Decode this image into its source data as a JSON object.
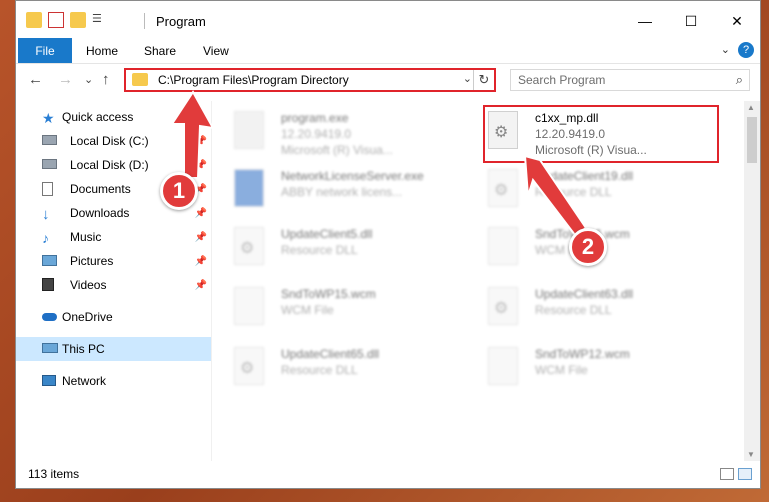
{
  "window": {
    "title": "Program",
    "controls": {
      "minimize": "—",
      "maximize": "☐",
      "close": "✕"
    }
  },
  "ribbon": {
    "file": "File",
    "tabs": [
      "Home",
      "Share",
      "View"
    ],
    "help": "?"
  },
  "address": {
    "path": "C:\\Program Files\\Program Directory",
    "refresh": "↻",
    "dropdown": "⌄"
  },
  "search": {
    "placeholder": "Search Program",
    "icon": "⌕"
  },
  "nav": {
    "back": "←",
    "forward": "→",
    "recent": "⌄",
    "up": "↑",
    "items": [
      {
        "label": "Quick access",
        "icon": "star-icon",
        "pinned": false
      },
      {
        "label": "Local Disk (C:)",
        "icon": "drive-icon",
        "pinned": true
      },
      {
        "label": "Local Disk (D:)",
        "icon": "drive-icon",
        "pinned": true
      },
      {
        "label": "Documents",
        "icon": "documents-icon",
        "pinned": true
      },
      {
        "label": "Downloads",
        "icon": "download-icon",
        "pinned": true
      },
      {
        "label": "Music",
        "icon": "music-icon",
        "pinned": true
      },
      {
        "label": "Pictures",
        "icon": "pictures-icon",
        "pinned": true
      },
      {
        "label": "Videos",
        "icon": "videos-icon",
        "pinned": true
      },
      {
        "label": "OneDrive",
        "icon": "cloud-icon",
        "pinned": false
      },
      {
        "label": "This PC",
        "icon": "computer-icon",
        "pinned": false
      },
      {
        "label": "Network",
        "icon": "network-icon",
        "pinned": false
      }
    ]
  },
  "files": [
    {
      "name": "program.exe",
      "line2": "12.20.9419.0",
      "line3": "Microsoft (R) Visua..."
    },
    {
      "name": "c1xx_mp.dll",
      "line2": "12.20.9419.0",
      "line3": "Microsoft (R) Visua..."
    },
    {
      "name": "NetworkLicenseServer.exe",
      "line2": "ABBY network licens...",
      "line3": ""
    },
    {
      "name": "UpdateClient19.dll",
      "line2": "Resource DLL",
      "line3": ""
    },
    {
      "name": "UpdateClient5.dll",
      "line2": "Resource DLL",
      "line3": ""
    },
    {
      "name": "SndToWP16.wcm",
      "line2": "WCM File",
      "line3": ""
    },
    {
      "name": "SndToWP15.wcm",
      "line2": "WCM File",
      "line3": ""
    },
    {
      "name": "UpdateClient63.dll",
      "line2": "Resource DLL",
      "line3": ""
    },
    {
      "name": "UpdateClient65.dll",
      "line2": "Resource DLL",
      "line3": ""
    },
    {
      "name": "SndToWP12.wcm",
      "line2": "WCM File",
      "line3": ""
    }
  ],
  "status": {
    "count": "113 items"
  },
  "annotations": {
    "badge1": "1",
    "badge2": "2",
    "color": "#e13b3b"
  },
  "colors": {
    "accent": "#1979ca",
    "highlight": "#e0242b",
    "selected": "#cce8ff"
  }
}
